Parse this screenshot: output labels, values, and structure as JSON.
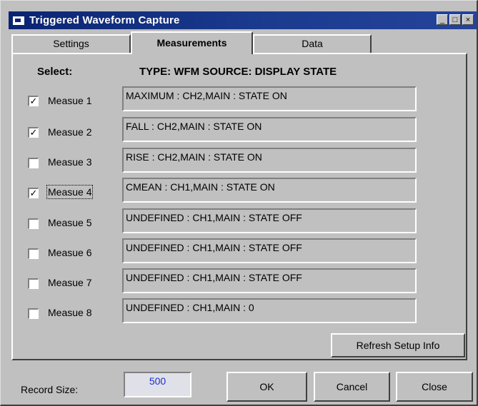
{
  "window": {
    "title": "Triggered Waveform Capture",
    "controls": [
      "_",
      "□",
      "×"
    ]
  },
  "tabs": [
    {
      "label": "Settings",
      "active": false
    },
    {
      "label": "Measurements",
      "active": true
    },
    {
      "label": "Data",
      "active": false
    }
  ],
  "headers": {
    "select": "Select:",
    "type": "TYPE:  WFM SOURCE:  DISPLAY STATE"
  },
  "measures": [
    {
      "label": "Measue 1",
      "checked": true,
      "value": "MAXIMUM : CH2,MAIN : STATE ON"
    },
    {
      "label": "Measue 2",
      "checked": true,
      "value": "FALL : CH2,MAIN : STATE ON"
    },
    {
      "label": "Measue 3",
      "checked": false,
      "value": "RISE : CH2,MAIN : STATE ON"
    },
    {
      "label": "Measue 4",
      "checked": true,
      "value": "CMEAN : CH1,MAIN : STATE ON"
    },
    {
      "label": "Measue 5",
      "checked": false,
      "value": "UNDEFINED : CH1,MAIN : STATE OFF"
    },
    {
      "label": "Measue 6",
      "checked": false,
      "value": "UNDEFINED : CH1,MAIN : STATE OFF"
    },
    {
      "label": "Measue 7",
      "checked": false,
      "value": "UNDEFINED : CH1,MAIN : STATE OFF"
    },
    {
      "label": "Measue 8",
      "checked": false,
      "value": "UNDEFINED : CH1,MAIN : 0"
    }
  ],
  "refresh_button": "Refresh Setup Info",
  "record": {
    "label": "Record Size:",
    "value": "500"
  },
  "footer_buttons": {
    "ok": "OK",
    "cancel": "Cancel",
    "close": "Close"
  },
  "check_mark": "✓"
}
